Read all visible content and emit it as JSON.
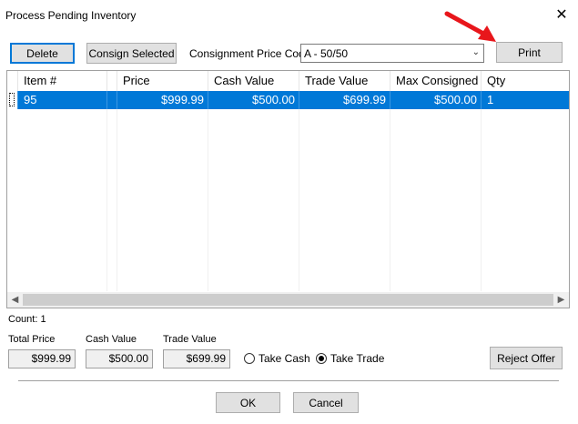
{
  "window": {
    "title": "Process Pending Inventory",
    "close_glyph": "✕"
  },
  "toolbar": {
    "delete_label": "Delete",
    "consign_selected_label": "Consign Selected",
    "price_code_label": "Consignment Price Code",
    "price_code_value": "A - 50/50",
    "print_label": "Print"
  },
  "grid": {
    "columns": [
      "Item #",
      "Price",
      "Cash Value",
      "Trade Value",
      "Max Consigned",
      "Qty"
    ],
    "rows": [
      {
        "item": "95",
        "price": "$999.99",
        "cash_value": "$500.00",
        "trade_value": "$699.99",
        "max_consigned": "$500.00",
        "qty": "1"
      }
    ],
    "selected_color": "#0078d7"
  },
  "summary": {
    "count": "Count: 1",
    "total_price_label": "Total Price",
    "total_price": "$999.99",
    "cash_value_label": "Cash Value",
    "cash_value": "$500.00",
    "trade_value_label": "Trade Value",
    "trade_value": "$699.99",
    "take_cash_label": "Take Cash",
    "take_trade_label": "Take Trade",
    "selected_option": "Take Trade",
    "reject_label": "Reject Offer"
  },
  "footer": {
    "ok_label": "OK",
    "cancel_label": "Cancel"
  },
  "annotation": {
    "arrow_color": "#e8161b"
  }
}
